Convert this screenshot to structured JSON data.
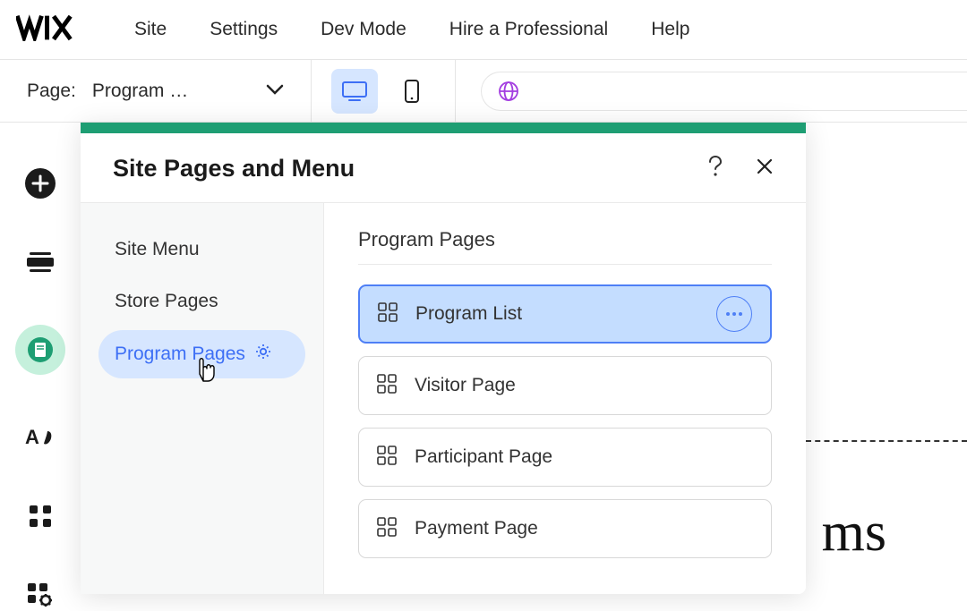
{
  "logo": "WIX",
  "menu": [
    "Site",
    "Settings",
    "Dev Mode",
    "Hire a Professional",
    "Help"
  ],
  "toolbar": {
    "page_label": "Page:",
    "current_page": "Program …"
  },
  "panel": {
    "title": "Site Pages and Menu",
    "sidebar": [
      {
        "label": "Site Menu",
        "active": false
      },
      {
        "label": "Store Pages",
        "active": false
      },
      {
        "label": "Program Pages",
        "active": true
      }
    ],
    "section_title": "Program Pages",
    "pages": [
      {
        "label": "Program List",
        "selected": true
      },
      {
        "label": "Visitor Page",
        "selected": false
      },
      {
        "label": "Participant Page",
        "selected": false
      },
      {
        "label": "Payment Page",
        "selected": false
      }
    ]
  },
  "background_preview": "ms"
}
